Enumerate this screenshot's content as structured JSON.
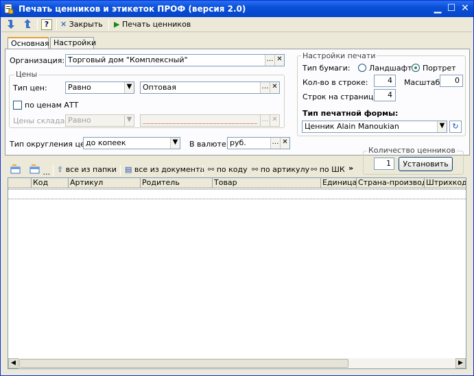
{
  "window": {
    "title": "Печать ценников и этикеток ПРОФ (версия 2.0)",
    "controls": {
      "minimize": "▁",
      "maximize": "☐",
      "close": "✕"
    }
  },
  "toolbar": {
    "close_label": "Закрыть",
    "print_label": "Печать ценников",
    "help_label": "?"
  },
  "tabs": [
    {
      "label": "Основная"
    },
    {
      "label": "Настройки"
    }
  ],
  "org": {
    "label": "Организация:",
    "value": "Торговый дом \"Комплексный\""
  },
  "prices": {
    "group_title": "Цены",
    "type_label": "Тип цен:",
    "type_value": "Равно",
    "type_ref": "Оптовая",
    "att_label": "по ценам АТТ",
    "warehouse_label": "Цены склада:",
    "warehouse_value": "Равно",
    "warehouse_ref": ""
  },
  "rounding": {
    "label": "Тип округления цен:",
    "value": "до копеек"
  },
  "currency": {
    "label": "В валюте:",
    "value": "руб."
  },
  "print_settings": {
    "group_title": "Настройки печати",
    "paper_label": "Тип бумаги:",
    "landscape_label": "Ландшафт",
    "portrait_label": "Портрет",
    "selected_orientation": "Портрет",
    "per_row_label": "Кол-во в строке:",
    "per_row_value": "4",
    "scale_label": "Масштаб:",
    "scale_value": "0",
    "rows_label": "Строк на странице:",
    "rows_value": "4",
    "form_label": "Тип печатной формы:",
    "form_value": "Ценник Alain Manoukian"
  },
  "quantity": {
    "group_title": "Количество ценников",
    "value": "1",
    "set_label": "Установить"
  },
  "list_toolbar": {
    "more_label": "...",
    "all_from_folder": "все из папки",
    "all_from_document": "все из документа",
    "by_code": "по коду",
    "by_article": "по артикулу",
    "by_barcode": "по ШК",
    "overflow": "»"
  },
  "grid": {
    "columns": [
      "Код",
      "Артикул",
      "Родитель",
      "Товар",
      "Единица",
      "Страна-производ...",
      "Штрихкод"
    ]
  },
  "colors": {
    "titlebar": "#0a4fd8",
    "accent_tab": "#e69f2f"
  }
}
